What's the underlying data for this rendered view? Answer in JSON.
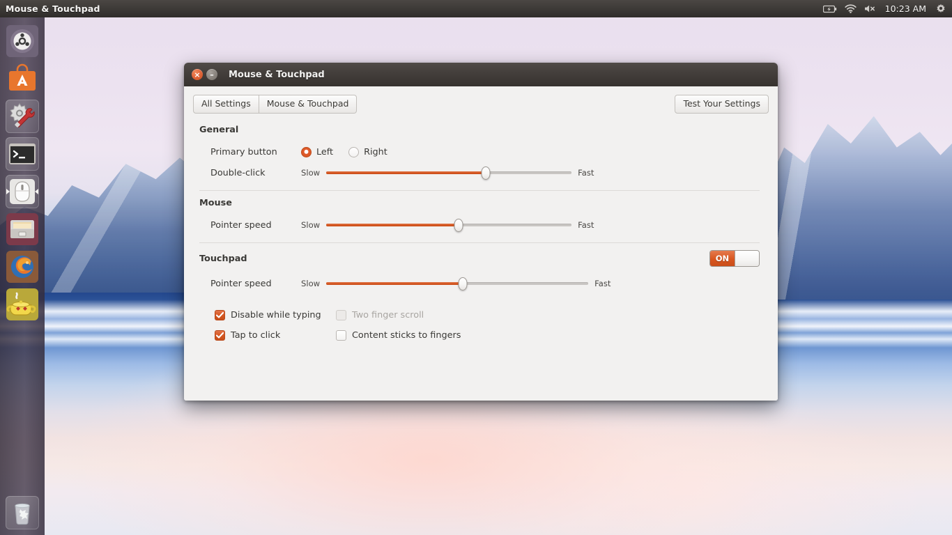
{
  "panel": {
    "title": "Mouse & Touchpad",
    "clock": "10:23 AM",
    "indicators": [
      {
        "name": "battery-icon"
      },
      {
        "name": "wifi-icon"
      },
      {
        "name": "volume-muted-icon"
      },
      {
        "name": "gear-icon"
      }
    ]
  },
  "launcher": {
    "items": [
      {
        "name": "ubuntu-dash-icon",
        "label": "Dash home"
      },
      {
        "name": "software-center-icon",
        "label": "Ubuntu Software Center"
      },
      {
        "name": "system-settings-icon",
        "label": "System Settings"
      },
      {
        "name": "terminal-icon",
        "label": "Terminal"
      },
      {
        "name": "mouse-settings-icon",
        "label": "Mouse & Touchpad"
      },
      {
        "name": "files-icon",
        "label": "Files"
      },
      {
        "name": "firefox-icon",
        "label": "Firefox Web Browser"
      },
      {
        "name": "teapot-icon",
        "label": "Amazon"
      }
    ],
    "trash": {
      "name": "trash-icon",
      "label": "Trash"
    }
  },
  "window": {
    "title": "Mouse & Touchpad",
    "close_glyph": "×",
    "minimize_glyph": "–"
  },
  "toolbar": {
    "all_settings_label": "All Settings",
    "current_panel_label": "Mouse & Touchpad",
    "test_settings_label": "Test Your Settings"
  },
  "general": {
    "section_label": "General",
    "primary_button": {
      "label": "Primary button",
      "options": [
        {
          "label": "Left",
          "selected": true
        },
        {
          "label": "Right",
          "selected": false
        }
      ]
    },
    "double_click": {
      "label": "Double-click",
      "min_label": "Slow",
      "max_label": "Fast",
      "value_percent": 65
    }
  },
  "mouse": {
    "section_label": "Mouse",
    "pointer_speed": {
      "label": "Pointer speed",
      "min_label": "Slow",
      "max_label": "Fast",
      "value_percent": 54
    }
  },
  "touchpad": {
    "section_label": "Touchpad",
    "enabled_toggle": {
      "label": "ON",
      "state": true
    },
    "pointer_speed": {
      "label": "Pointer speed",
      "min_label": "Slow",
      "max_label": "Fast",
      "value_percent": 52
    },
    "checkboxes": [
      {
        "label": "Disable while typing",
        "checked": true,
        "disabled": false
      },
      {
        "label": "Two finger scroll",
        "checked": false,
        "disabled": true
      },
      {
        "label": "Tap to click",
        "checked": true,
        "disabled": false
      },
      {
        "label": "Content sticks to fingers",
        "checked": false,
        "disabled": false
      }
    ]
  },
  "colors": {
    "accent_orange": "#d4551f",
    "panel_dark": "#3d3a37",
    "window_bg": "#f2f1f0",
    "text": "#3a3936"
  }
}
